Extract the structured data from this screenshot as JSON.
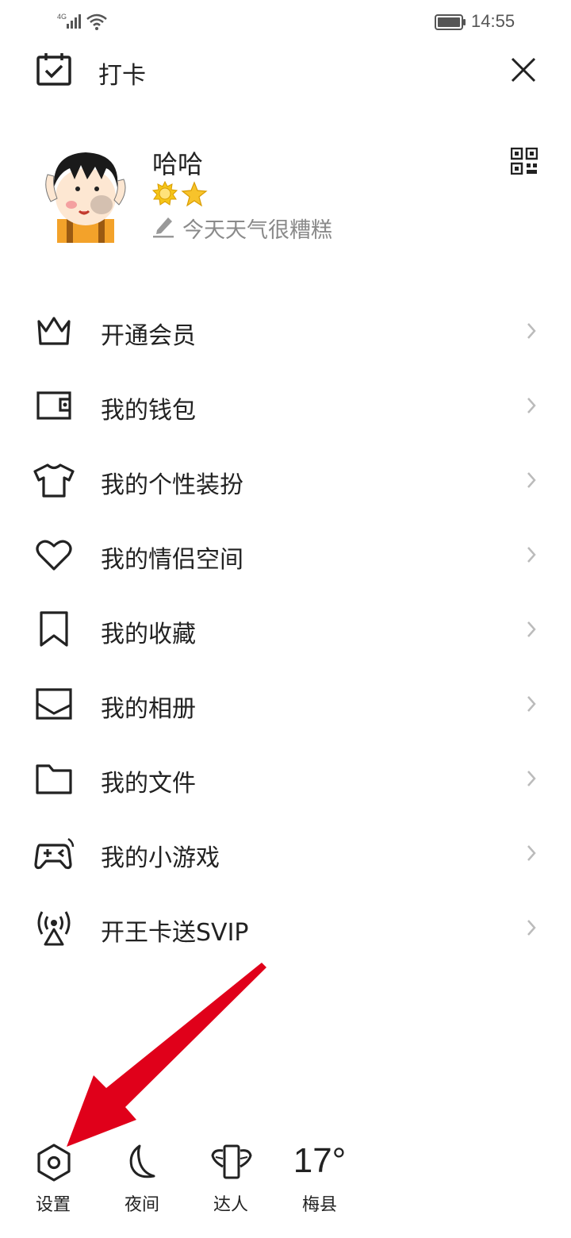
{
  "status_bar": {
    "network": "4G",
    "time": "14:55"
  },
  "header": {
    "checkin_label": "打卡"
  },
  "profile": {
    "username": "哈哈",
    "signature": "今天天气很糟糕"
  },
  "menu": {
    "items": [
      {
        "label": "开通会员",
        "icon": "crown-icon"
      },
      {
        "label": "我的钱包",
        "icon": "wallet-icon"
      },
      {
        "label": "我的个性装扮",
        "icon": "tshirt-icon"
      },
      {
        "label": "我的情侣空间",
        "icon": "heart-icon"
      },
      {
        "label": "我的收藏",
        "icon": "bookmark-icon"
      },
      {
        "label": "我的相册",
        "icon": "image-icon"
      },
      {
        "label": "我的文件",
        "icon": "folder-icon"
      },
      {
        "label": "我的小游戏",
        "icon": "gamepad-icon"
      },
      {
        "label": "开王卡送SVIP",
        "icon": "signal-tower-icon"
      }
    ]
  },
  "bottom_bar": {
    "settings_label": "设置",
    "night_label": "夜间",
    "expert_label": "达人",
    "temperature": "17°",
    "city": "梅县"
  },
  "colors": {
    "text": "#222222",
    "secondary_text": "#8a8a8a",
    "annotation_arrow": "#e0001a",
    "badge_yellow": "#f5c518"
  }
}
